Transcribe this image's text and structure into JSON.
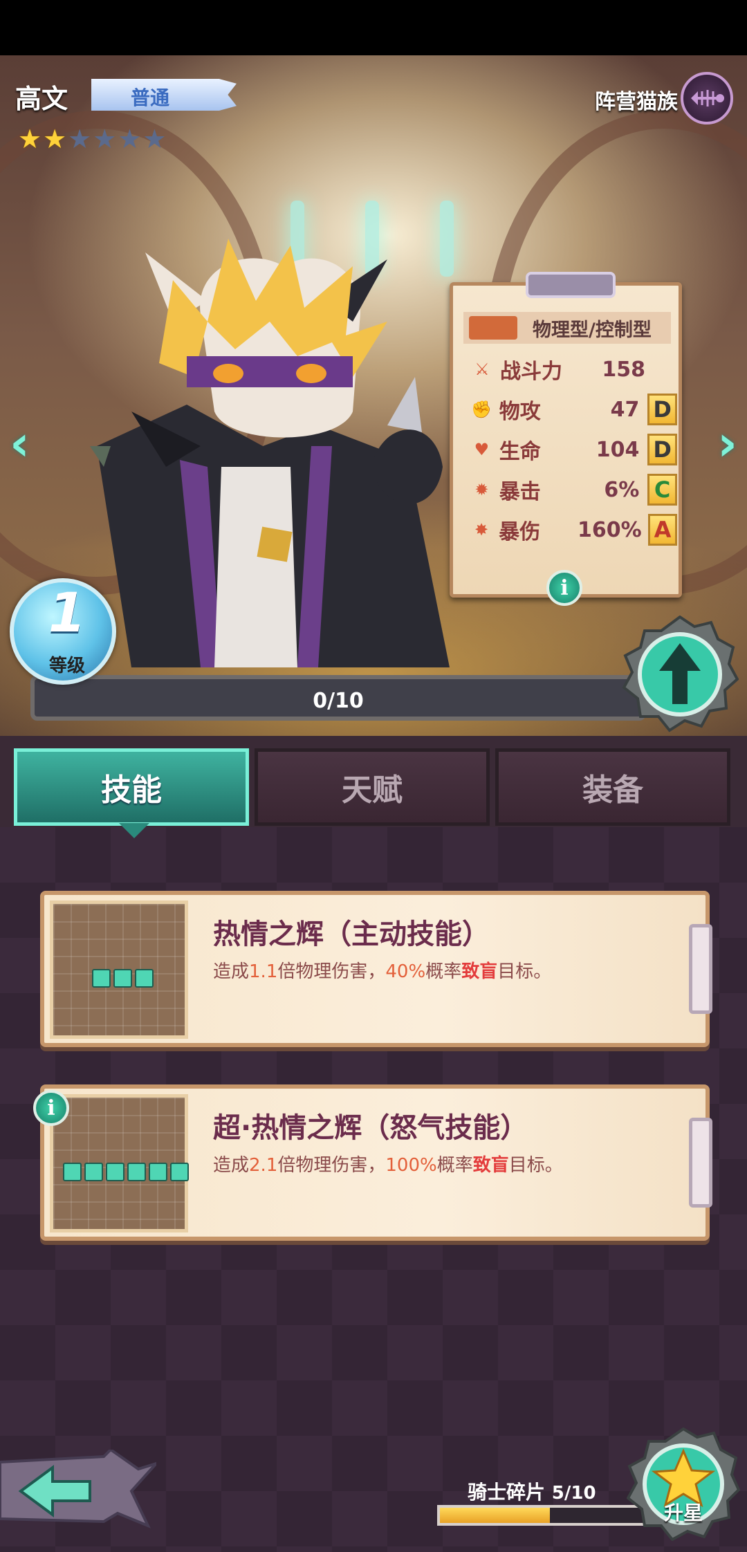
{
  "hero": {
    "name": "高文",
    "rarity": "普通",
    "stars_filled": 2,
    "stars_total": 6,
    "faction_label": "阵营猫族",
    "faction_icon": "fish-bone-icon"
  },
  "stats": {
    "type": "物理型/控制型",
    "rows": [
      {
        "icon": "crossed-swords-icon",
        "label": "战斗力",
        "value": "158",
        "grade": ""
      },
      {
        "icon": "fist-icon",
        "label": "物攻",
        "value": "47",
        "grade": "D"
      },
      {
        "icon": "heart-icon",
        "label": "生命",
        "value": "104",
        "grade": "D"
      },
      {
        "icon": "crit-burst-icon",
        "label": "暴击",
        "value": "6%",
        "grade": "C"
      },
      {
        "icon": "crit-damage-icon",
        "label": "暴伤",
        "value": "160%",
        "grade": "A"
      }
    ],
    "grade_colors": {
      "D": "#3a3a3a",
      "C": "#2a8a3a",
      "A": "#c0392b"
    }
  },
  "level": {
    "value": "1",
    "label": "等级",
    "exp_text": "0/10",
    "exp_fraction": 0
  },
  "tabs": [
    {
      "label": "技能",
      "active": true
    },
    {
      "label": "天赋",
      "active": false
    },
    {
      "label": "装备",
      "active": false
    }
  ],
  "skills": [
    {
      "title": "热情之辉（主动技能）",
      "desc_pre": "造成",
      "desc_mult": "1.1",
      "desc_mid": "倍物理伤害，",
      "desc_pct": "40%",
      "desc_mid2": "概率",
      "desc_effect": "致盲",
      "desc_post": "目标。",
      "pips": 3
    },
    {
      "title": "超·热情之辉（怒气技能）",
      "desc_pre": "造成",
      "desc_mult": "2.1",
      "desc_mid": "倍物理伤害，",
      "desc_pct": "100%",
      "desc_mid2": "概率",
      "desc_effect": "致盲",
      "desc_post": "目标。",
      "pips": 6
    }
  ],
  "shards": {
    "label": "骑士碎片",
    "count": "5/10",
    "fraction": 0.5
  },
  "star_up": {
    "label": "升星"
  },
  "colors": {
    "accent": "#3fb3a0",
    "panel": "#3b2a3c",
    "card": "#f7e6cc"
  }
}
